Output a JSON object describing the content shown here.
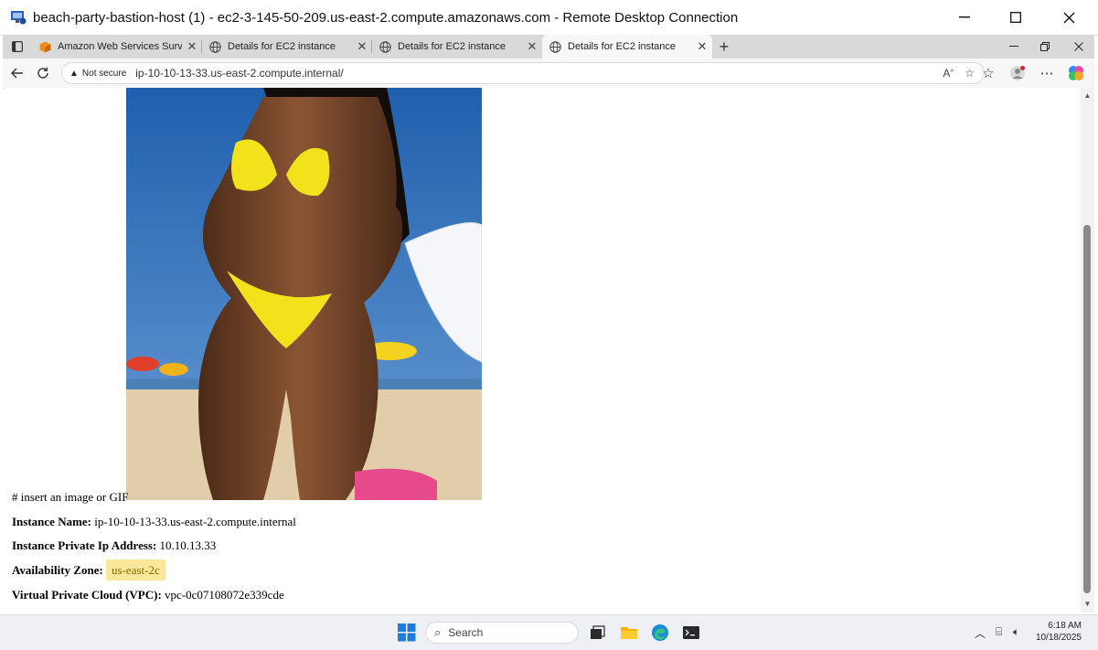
{
  "window": {
    "title": "beach-party-bastion-host (1) - ec2-3-145-50-209.us-east-2.compute.amazonaws.com - Remote Desktop Connection",
    "minimize": "—",
    "maximize": "☐",
    "close": "✕"
  },
  "browser": {
    "tabs": [
      {
        "label": "Amazon Web Services Survey",
        "icon": "aws-cube-icon",
        "active": false
      },
      {
        "label": "Details for EC2 instance",
        "icon": "globe-icon",
        "active": false
      },
      {
        "label": "Details for EC2 instance",
        "icon": "globe-icon",
        "active": false
      },
      {
        "label": "Details for EC2 instance",
        "icon": "globe-icon",
        "active": true
      }
    ],
    "new_tab": "+",
    "security_label": "Not secure",
    "url": "ip-10-10-13-33.us-east-2.compute.internal/"
  },
  "page": {
    "image_caption": "# insert an image or GIF",
    "fields": [
      {
        "label": "Instance Name:",
        "value": "ip-10-10-13-33.us-east-2.compute.internal",
        "highlight": false
      },
      {
        "label": "Instance Private Ip Address:",
        "value": "10.10.13.33",
        "highlight": false
      },
      {
        "label": "Availability Zone:",
        "value": "us-east-2c",
        "highlight": true
      },
      {
        "label": "Virtual Private Cloud (VPC):",
        "value": "vpc-0c07108072e339cde",
        "highlight": false
      }
    ]
  },
  "taskbar": {
    "search_placeholder": "Search",
    "time": "6:18 AM",
    "date": "10/18/2025"
  },
  "colors": {
    "highlight": "#fce89a",
    "tab_strip": "#d9d9d9",
    "sky": "#2f6fb5",
    "sand": "#e2cdaa",
    "bikini": "#f1e21c"
  }
}
